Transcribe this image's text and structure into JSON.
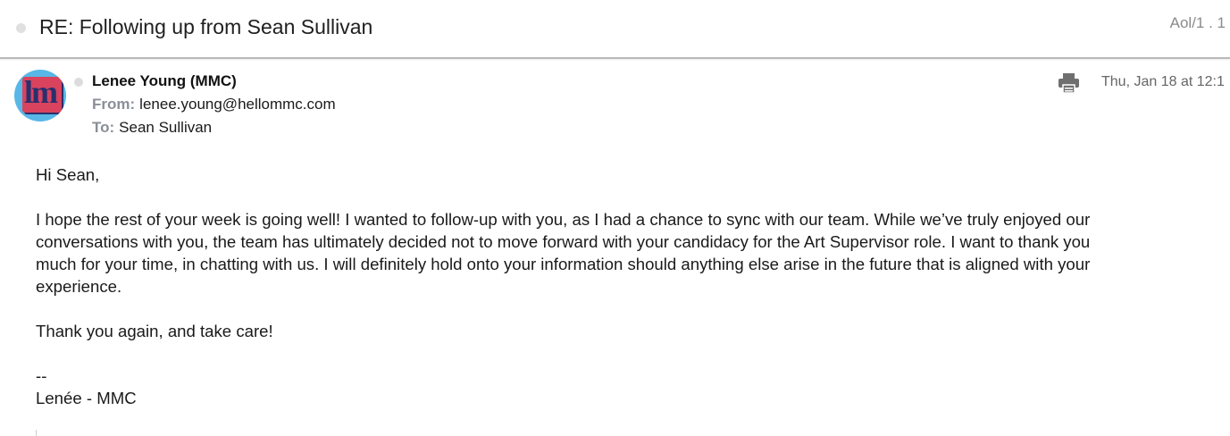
{
  "email": {
    "subject": "RE: Following up from Sean Sullivan",
    "folder": "Aol/1 . 1",
    "sender": {
      "name": "Lenee Young (MMC)",
      "avatar_text": "lm",
      "from_label": "From:",
      "from_address": "lenee.young@hellommc.com",
      "to_label": "To:",
      "to_name": "Sean Sullivan"
    },
    "date": "Thu, Jan 18 at 12:1",
    "icons": {
      "print": "print-icon"
    },
    "body": {
      "greeting": "Hi Sean,",
      "paragraph_lines": [
        "I hope the rest of your week is going well!  I wanted to follow-up with you, as I had a chance to sync with our team.  While we’ve truly enjoyed our",
        "conversations with you, the team has ultimately decided not to move forward with your candidacy for the Art Supervisor role.  I want to thank you",
        "much for your time, in chatting with us.  I will definitely hold onto your information should anything else arise in the future that is aligned with your",
        "experience."
      ],
      "closing": "Thank you again, and take care!",
      "sig_separator": "--",
      "signature": "Lenée - MMC"
    }
  },
  "colors": {
    "avatar_bg": "#58b7e6",
    "avatar_block": "#d9435e",
    "avatar_text": "#2a2f6e",
    "meta_label": "#8a8f98"
  }
}
